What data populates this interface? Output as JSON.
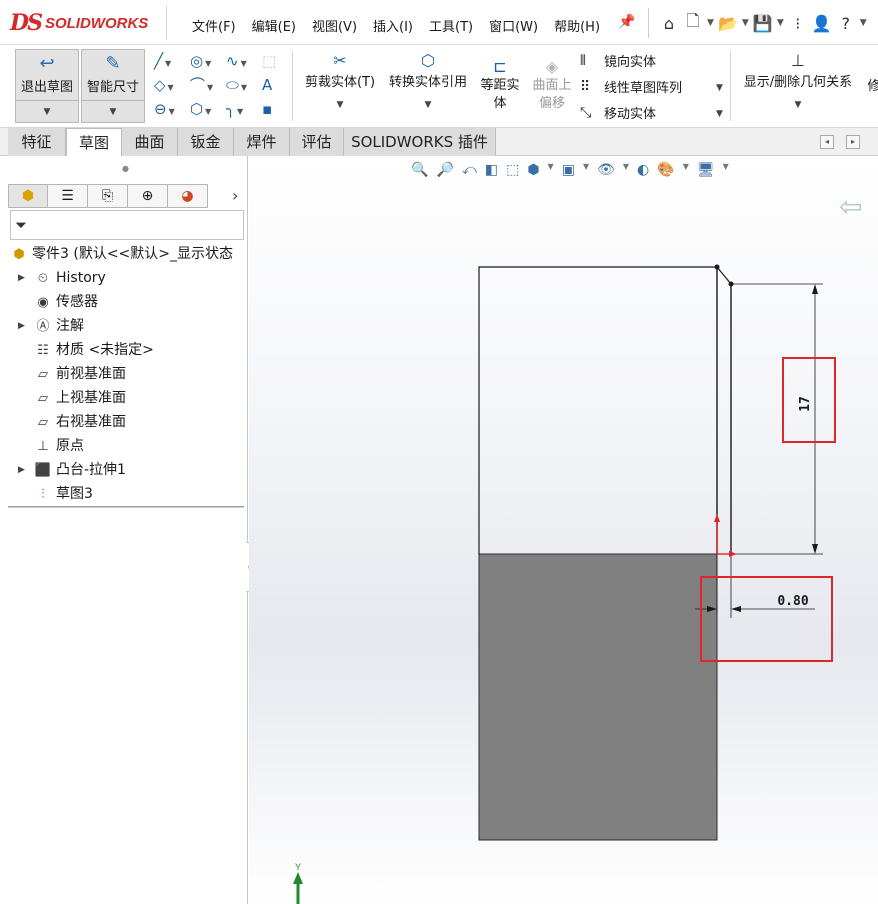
{
  "app": {
    "logo_ds": "DS",
    "logo_text": "SOLIDWORKS"
  },
  "menu": [
    "文件(F)",
    "编辑(E)",
    "视图(V)",
    "插入(I)",
    "工具(T)",
    "窗口(W)",
    "帮助(H)"
  ],
  "quick_icons": [
    "pin-icon",
    "home-icon",
    "new-doc-icon",
    "open-icon",
    "save-icon",
    "print-icon",
    "user-icon",
    "help-icon"
  ],
  "command_manager": {
    "exit_sketch": "退出草图",
    "smart_dimension": "智能尺寸",
    "trim": "剪裁实体(T)",
    "convert": "转换实体引用",
    "offset": "等距实体",
    "surface_offset_line1": "曲面上",
    "surface_offset_line2": "偏移",
    "mirror": "镜向实体",
    "linear_pattern": "线性草图阵列",
    "move": "移动实体",
    "display_relations": "显示/删除几何关系",
    "repair": "修"
  },
  "tabs": [
    "特征",
    "草图",
    "曲面",
    "钣金",
    "焊件",
    "评估",
    "SOLIDWORKS 插件"
  ],
  "active_tab": "草图",
  "feature_tree": {
    "root": "零件3 (默认<<默认>_显示状态",
    "items": [
      "History",
      "传感器",
      "注解",
      "材质 <未指定>",
      "前视基准面",
      "上视基准面",
      "右视基准面",
      "原点",
      "凸台-拉伸1",
      "草图3"
    ]
  },
  "dimensions": {
    "vertical": "17",
    "horizontal": "0.80"
  },
  "axis_label": "Y",
  "colors": {
    "highlight_box": "#e0262b",
    "solid_fill": "#808080",
    "accent": "#2a6ab0"
  }
}
